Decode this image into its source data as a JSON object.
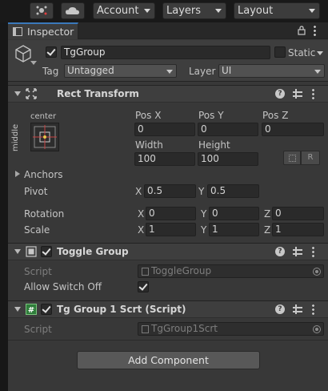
{
  "toolbar": {
    "account_label": "Account",
    "layers_label": "Layers",
    "layout_label": "Layout"
  },
  "tab": {
    "label": "Inspector"
  },
  "gameobject": {
    "name": "TgGroup",
    "static_label": "Static",
    "tag_label": "Tag",
    "tag_value": "Untagged",
    "layer_label": "Layer",
    "layer_value": "UI"
  },
  "rect_transform": {
    "title": "Rect Transform",
    "anchor_preset_label": "center",
    "anchor_vertical_label": "middle",
    "pos_x_label": "Pos X",
    "pos_y_label": "Pos Y",
    "pos_z_label": "Pos Z",
    "pos_x": "0",
    "pos_y": "0",
    "pos_z": "0",
    "width_label": "Width",
    "height_label": "Height",
    "width": "100",
    "height": "100",
    "raw_edit_label": "R",
    "anchors_label": "Anchors",
    "pivot_label": "Pivot",
    "pivot_x_label": "X",
    "pivot_x": "0.5",
    "pivot_y_label": "Y",
    "pivot_y": "0.5",
    "rotation_label": "Rotation",
    "rot_x_label": "X",
    "rot_x": "0",
    "rot_y_label": "Y",
    "rot_y": "0",
    "rot_z_label": "Z",
    "rot_z": "0",
    "scale_label": "Scale",
    "scale_x_label": "X",
    "scale_x": "1",
    "scale_y_label": "Y",
    "scale_y": "1",
    "scale_z_label": "Z",
    "scale_z": "1"
  },
  "toggle_group": {
    "title": "Toggle Group",
    "script_label": "Script",
    "script_value": "ToggleGroup",
    "allow_switch_off_label": "Allow Switch Off",
    "allow_switch_off": true
  },
  "tg_script": {
    "title": "Tg Group 1 Scrt (Script)",
    "script_label": "Script",
    "script_value": "TgGroup1Scrt"
  },
  "add_component_label": "Add Component",
  "colors": {
    "accent_tab": "#3a79bb",
    "panel": "#383838",
    "field": "#2a2a2a"
  },
  "icons": {
    "toolbar_collab": "collab-icon",
    "toolbar_cloud": "cloud-icon",
    "gameobject": "cube-icon",
    "rect_transform": "rect-transform-icon",
    "toggle_group": "toggle-group-icon",
    "script": "csharp-script-icon"
  }
}
